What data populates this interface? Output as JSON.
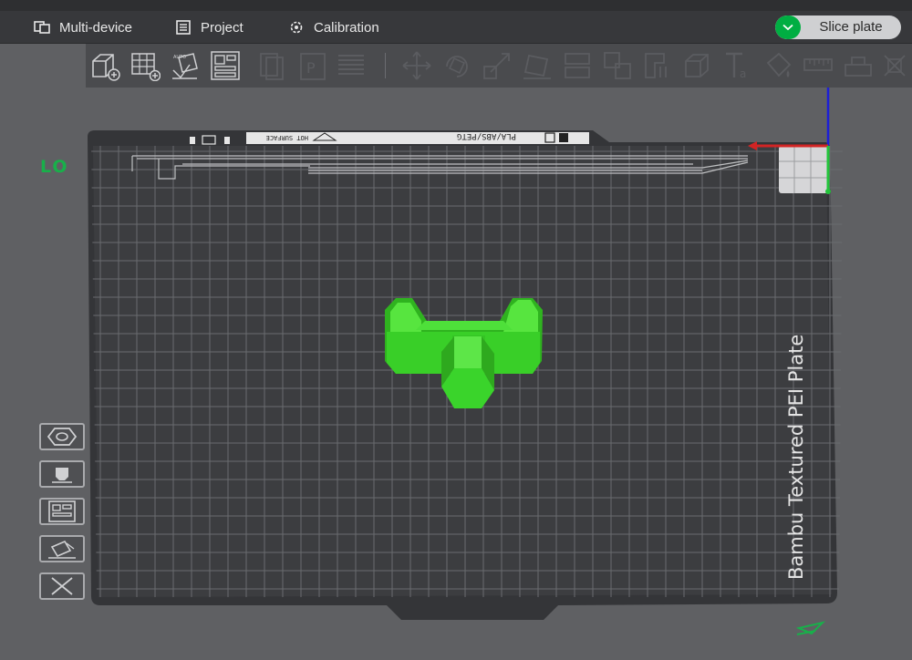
{
  "menubar": {
    "multi_device": "Multi-device",
    "project": "Project",
    "calibration": "Calibration",
    "slice_plate": "Slice plate"
  },
  "plate": {
    "name": "Bambu Textured PEI Plate",
    "filament_label": "PLA/ABS/PETG",
    "hot_surface_label": "HOT SURFACE"
  },
  "viewport": {
    "lo_label": "LO"
  },
  "toolbar": {
    "icons": [
      "add-icon",
      "add-plate-icon",
      "auto-orient-icon",
      "arrange-icon",
      "copy-icon",
      "paste-icon",
      "layers-icon",
      "move-icon",
      "rotate-icon",
      "scale-icon",
      "lay-on-face-icon",
      "cut-icon",
      "split-icon",
      "support-paint-icon",
      "seam-paint-icon",
      "text-icon",
      "color-paint-icon",
      "measure-icon",
      "assembly-icon",
      "more-icon"
    ]
  },
  "colors": {
    "accent": "#00ae42",
    "plate": "#3b3c3f",
    "model": "#3ad42b",
    "background": "#5f6063"
  }
}
